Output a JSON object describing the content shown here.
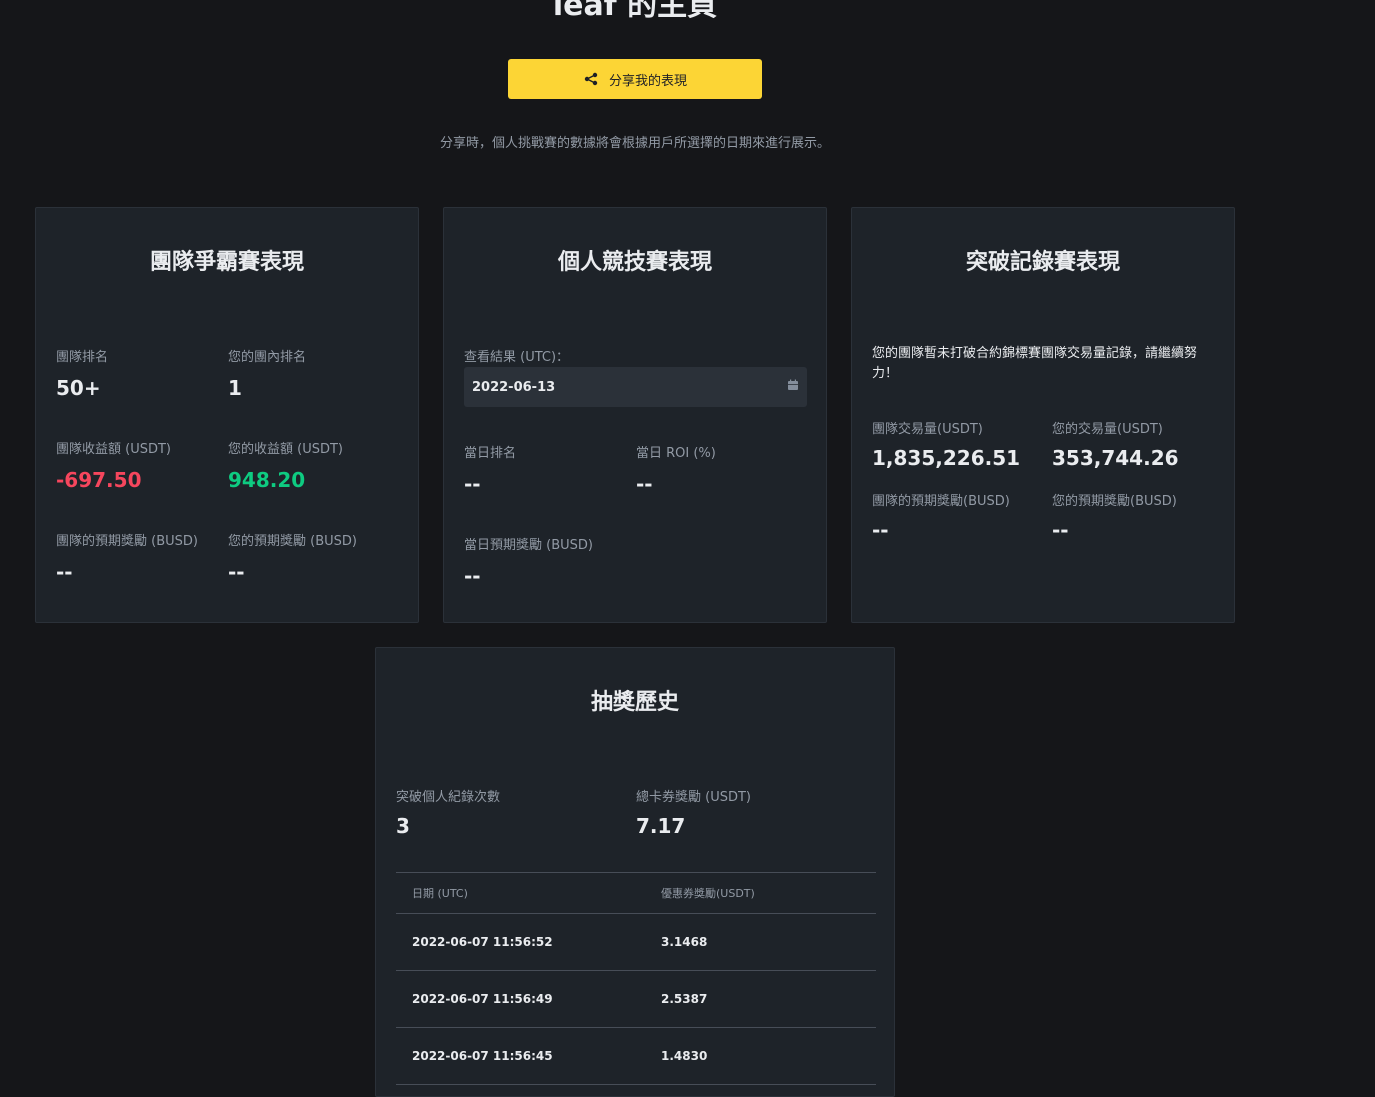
{
  "page": {
    "title": "leaf 的主頁",
    "share_button": "分享我的表現",
    "share_note": "分享時，個人挑戰賽的數據將會根據用戶所選擇的日期來進行展示。"
  },
  "team_card": {
    "title": "團隊爭霸賽表現",
    "team_rank_label": "團隊排名",
    "team_rank": "50+",
    "my_rank_label": "您的團內排名",
    "my_rank": "1",
    "team_pnl_label": "團隊收益額 (USDT)",
    "team_pnl": "-697.50",
    "my_pnl_label": "您的收益額 (USDT)",
    "my_pnl": "948.20",
    "team_reward_label": "團隊的預期獎勵 (BUSD)",
    "team_reward": "--",
    "my_reward_label": "您的預期獎勵 (BUSD)",
    "my_reward": "--"
  },
  "individual_card": {
    "title": "個人競技賽表現",
    "date_label": "查看結果 (UTC)：",
    "date_value": "2022-06-13",
    "daily_rank_label": "當日排名",
    "daily_rank": "--",
    "daily_roi_label": "當日 ROI (%)",
    "daily_roi": "--",
    "daily_reward_label": "當日預期獎勵 (BUSD)",
    "daily_reward": "--"
  },
  "record_card": {
    "title": "突破記錄賽表現",
    "note": "您的團隊暫未打破合約錦標賽團隊交易量記錄，請繼續努力！",
    "team_volume_label": "團隊交易量(USDT)",
    "team_volume": "1,835,226.51",
    "my_volume_label": "您的交易量(USDT)",
    "my_volume": "353,744.26",
    "team_reward_label": "團隊的預期獎勵(BUSD)",
    "team_reward": "--",
    "my_reward_label": "您的預期獎勵(BUSD)",
    "my_reward": "--"
  },
  "lottery_card": {
    "title": "抽獎歷史",
    "break_count_label": "突破個人紀錄次數",
    "break_count": "3",
    "total_voucher_label": "總卡券獎勵 (USDT)",
    "total_voucher": "7.17",
    "table": {
      "headers": [
        "日期 (UTC)",
        "優惠券獎勵(USDT)"
      ],
      "rows": [
        [
          "2022-06-07 11:56:52",
          "3.1468"
        ],
        [
          "2022-06-07 11:56:49",
          "2.5387"
        ],
        [
          "2022-06-07 11:56:45",
          "1.4830"
        ]
      ]
    }
  },
  "colors": {
    "background": "#151619",
    "card": "#1e2329",
    "accent": "#fcd535",
    "negative": "#f6465d",
    "positive": "#0ecb81"
  },
  "icons": {
    "share": "share-icon",
    "calendar": "calendar-icon"
  }
}
